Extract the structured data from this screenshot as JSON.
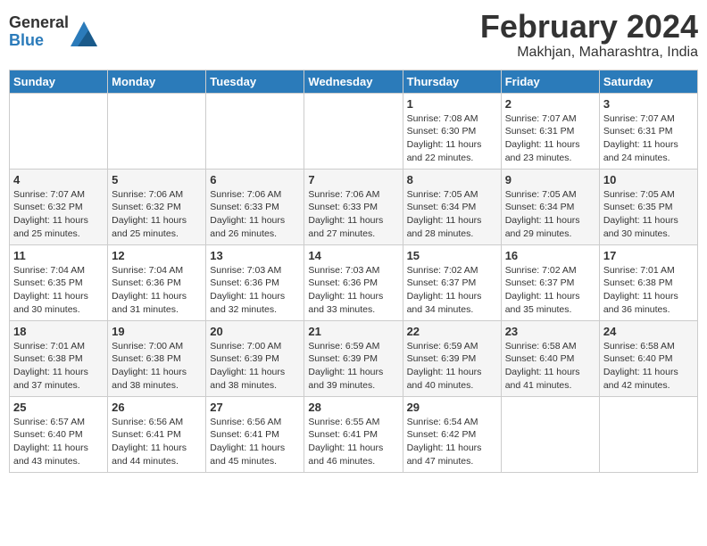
{
  "header": {
    "logo_general": "General",
    "logo_blue": "Blue",
    "month": "February 2024",
    "location": "Makhjan, Maharashtra, India"
  },
  "columns": [
    "Sunday",
    "Monday",
    "Tuesday",
    "Wednesday",
    "Thursday",
    "Friday",
    "Saturday"
  ],
  "weeks": [
    [
      {
        "day": "",
        "info": ""
      },
      {
        "day": "",
        "info": ""
      },
      {
        "day": "",
        "info": ""
      },
      {
        "day": "",
        "info": ""
      },
      {
        "day": "1",
        "info": "Sunrise: 7:08 AM\nSunset: 6:30 PM\nDaylight: 11 hours and 22 minutes."
      },
      {
        "day": "2",
        "info": "Sunrise: 7:07 AM\nSunset: 6:31 PM\nDaylight: 11 hours and 23 minutes."
      },
      {
        "day": "3",
        "info": "Sunrise: 7:07 AM\nSunset: 6:31 PM\nDaylight: 11 hours and 24 minutes."
      }
    ],
    [
      {
        "day": "4",
        "info": "Sunrise: 7:07 AM\nSunset: 6:32 PM\nDaylight: 11 hours and 25 minutes."
      },
      {
        "day": "5",
        "info": "Sunrise: 7:06 AM\nSunset: 6:32 PM\nDaylight: 11 hours and 25 minutes."
      },
      {
        "day": "6",
        "info": "Sunrise: 7:06 AM\nSunset: 6:33 PM\nDaylight: 11 hours and 26 minutes."
      },
      {
        "day": "7",
        "info": "Sunrise: 7:06 AM\nSunset: 6:33 PM\nDaylight: 11 hours and 27 minutes."
      },
      {
        "day": "8",
        "info": "Sunrise: 7:05 AM\nSunset: 6:34 PM\nDaylight: 11 hours and 28 minutes."
      },
      {
        "day": "9",
        "info": "Sunrise: 7:05 AM\nSunset: 6:34 PM\nDaylight: 11 hours and 29 minutes."
      },
      {
        "day": "10",
        "info": "Sunrise: 7:05 AM\nSunset: 6:35 PM\nDaylight: 11 hours and 30 minutes."
      }
    ],
    [
      {
        "day": "11",
        "info": "Sunrise: 7:04 AM\nSunset: 6:35 PM\nDaylight: 11 hours and 30 minutes."
      },
      {
        "day": "12",
        "info": "Sunrise: 7:04 AM\nSunset: 6:36 PM\nDaylight: 11 hours and 31 minutes."
      },
      {
        "day": "13",
        "info": "Sunrise: 7:03 AM\nSunset: 6:36 PM\nDaylight: 11 hours and 32 minutes."
      },
      {
        "day": "14",
        "info": "Sunrise: 7:03 AM\nSunset: 6:36 PM\nDaylight: 11 hours and 33 minutes."
      },
      {
        "day": "15",
        "info": "Sunrise: 7:02 AM\nSunset: 6:37 PM\nDaylight: 11 hours and 34 minutes."
      },
      {
        "day": "16",
        "info": "Sunrise: 7:02 AM\nSunset: 6:37 PM\nDaylight: 11 hours and 35 minutes."
      },
      {
        "day": "17",
        "info": "Sunrise: 7:01 AM\nSunset: 6:38 PM\nDaylight: 11 hours and 36 minutes."
      }
    ],
    [
      {
        "day": "18",
        "info": "Sunrise: 7:01 AM\nSunset: 6:38 PM\nDaylight: 11 hours and 37 minutes."
      },
      {
        "day": "19",
        "info": "Sunrise: 7:00 AM\nSunset: 6:38 PM\nDaylight: 11 hours and 38 minutes."
      },
      {
        "day": "20",
        "info": "Sunrise: 7:00 AM\nSunset: 6:39 PM\nDaylight: 11 hours and 38 minutes."
      },
      {
        "day": "21",
        "info": "Sunrise: 6:59 AM\nSunset: 6:39 PM\nDaylight: 11 hours and 39 minutes."
      },
      {
        "day": "22",
        "info": "Sunrise: 6:59 AM\nSunset: 6:39 PM\nDaylight: 11 hours and 40 minutes."
      },
      {
        "day": "23",
        "info": "Sunrise: 6:58 AM\nSunset: 6:40 PM\nDaylight: 11 hours and 41 minutes."
      },
      {
        "day": "24",
        "info": "Sunrise: 6:58 AM\nSunset: 6:40 PM\nDaylight: 11 hours and 42 minutes."
      }
    ],
    [
      {
        "day": "25",
        "info": "Sunrise: 6:57 AM\nSunset: 6:40 PM\nDaylight: 11 hours and 43 minutes."
      },
      {
        "day": "26",
        "info": "Sunrise: 6:56 AM\nSunset: 6:41 PM\nDaylight: 11 hours and 44 minutes."
      },
      {
        "day": "27",
        "info": "Sunrise: 6:56 AM\nSunset: 6:41 PM\nDaylight: 11 hours and 45 minutes."
      },
      {
        "day": "28",
        "info": "Sunrise: 6:55 AM\nSunset: 6:41 PM\nDaylight: 11 hours and 46 minutes."
      },
      {
        "day": "29",
        "info": "Sunrise: 6:54 AM\nSunset: 6:42 PM\nDaylight: 11 hours and 47 minutes."
      },
      {
        "day": "",
        "info": ""
      },
      {
        "day": "",
        "info": ""
      }
    ]
  ]
}
